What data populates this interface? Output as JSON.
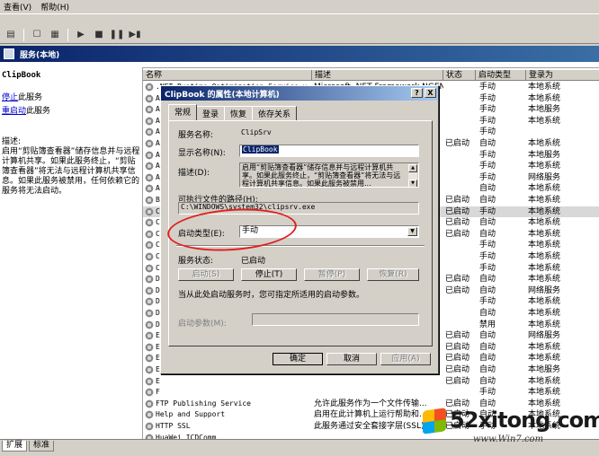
{
  "menu": [
    "查看(V)",
    "帮助(H)"
  ],
  "toolbar_icons": [
    "view-icon",
    "properties-icon",
    "list-icon",
    "play-icon",
    "stop-icon",
    "pause-icon",
    "step-icon"
  ],
  "header": {
    "title": "服务(本地)"
  },
  "left": {
    "title": "ClipBook",
    "stop_link": "停止",
    "stop_suffix": "此服务",
    "restart_link": "重启动",
    "restart_suffix": "此服务",
    "desc_label": "描述:",
    "desc_text": "启用“剪贴簿查看器”储存信息并与远程计算机共享。如果此服务终止，“剪贴簿查看器”将无法与远程计算机共享信息。如果此服务被禁用，任何依赖它的服务将无法启动。"
  },
  "columns": {
    "name": "名称",
    "desc": "描述",
    "status": "状态",
    "start": "启动类型",
    "logon": "登录为"
  },
  "rows": [
    {
      "name": ".NET Runtime Optimization Service v...",
      "desc": "Microsoft .NET Framework NGEN",
      "status": "",
      "start": "手动",
      "logon": "本地系统"
    },
    {
      "name": "A",
      "desc": "",
      "status": "",
      "start": "手动",
      "logon": "本地系统"
    },
    {
      "name": "A",
      "desc": "",
      "status": "",
      "start": "手动",
      "logon": "本地服务"
    },
    {
      "name": "A",
      "desc": "",
      "status": "",
      "start": "手动",
      "logon": "本地系统"
    },
    {
      "name": "A",
      "desc": "",
      "status": "",
      "start": "手动",
      "logon": ""
    },
    {
      "name": "A",
      "desc": "",
      "status": "已启动",
      "start": "自动",
      "logon": "本地系统"
    },
    {
      "name": "A",
      "desc": "",
      "status": "",
      "start": "手动",
      "logon": "本地服务"
    },
    {
      "name": "A",
      "desc": "",
      "status": "",
      "start": "手动",
      "logon": "本地系统"
    },
    {
      "name": "A",
      "desc": "",
      "status": "",
      "start": "手动",
      "logon": "网络服务"
    },
    {
      "name": "A",
      "desc": "",
      "status": "",
      "start": "自动",
      "logon": "本地系统"
    },
    {
      "name": "B",
      "desc": "",
      "status": "已启动",
      "start": "自动",
      "logon": "本地系统"
    },
    {
      "name": "C",
      "desc": "",
      "status": "已启动",
      "start": "手动",
      "logon": "本地系统"
    },
    {
      "name": "C",
      "desc": "",
      "status": "已启动",
      "start": "自动",
      "logon": "本地系统"
    },
    {
      "name": "C",
      "desc": "",
      "status": "已启动",
      "start": "自动",
      "logon": "本地系统"
    },
    {
      "name": "C",
      "desc": "",
      "status": "",
      "start": "手动",
      "logon": "本地系统"
    },
    {
      "name": "C",
      "desc": "",
      "status": "",
      "start": "手动",
      "logon": "本地系统"
    },
    {
      "name": "C",
      "desc": "",
      "status": "",
      "start": "手动",
      "logon": "本地系统"
    },
    {
      "name": "D",
      "desc": "",
      "status": "已启动",
      "start": "自动",
      "logon": "本地系统"
    },
    {
      "name": "D",
      "desc": "",
      "status": "已启动",
      "start": "自动",
      "logon": "网络服务"
    },
    {
      "name": "D",
      "desc": "",
      "status": "",
      "start": "手动",
      "logon": "本地系统"
    },
    {
      "name": "D",
      "desc": "",
      "status": "",
      "start": "自动",
      "logon": "本地系统"
    },
    {
      "name": "D",
      "desc": "",
      "status": "",
      "start": "禁用",
      "logon": "本地系统"
    },
    {
      "name": "E",
      "desc": "",
      "status": "已启动",
      "start": "自动",
      "logon": "网络服务"
    },
    {
      "name": "E",
      "desc": "",
      "status": "已启动",
      "start": "自动",
      "logon": "本地系统"
    },
    {
      "name": "E",
      "desc": "",
      "status": "已启动",
      "start": "自动",
      "logon": "本地系统"
    },
    {
      "name": "E",
      "desc": "",
      "status": "已启动",
      "start": "自动",
      "logon": "本地服务"
    },
    {
      "name": "E",
      "desc": "",
      "status": "已启动",
      "start": "自动",
      "logon": "本地系统"
    },
    {
      "name": "F",
      "desc": "",
      "status": "",
      "start": "手动",
      "logon": "本地系统"
    },
    {
      "name": "FTP Publishing Service",
      "desc": "允许此服务作为一个文件传输...",
      "status": "已启动",
      "start": "自动",
      "logon": "本地系统"
    },
    {
      "name": "Help and Support",
      "desc": "启用在此计算机上运行帮助和...",
      "status": "已启动",
      "start": "自动",
      "logon": "本地系统"
    },
    {
      "name": "HTTP SSL",
      "desc": "此服务通过安全套接字层(SSL)...",
      "status": "已启动",
      "start": "手动",
      "logon": "本地系统"
    },
    {
      "name": "HuaWei ICDComm",
      "desc": "",
      "status": "",
      "start": "",
      "logon": ""
    },
    {
      "name": "Human Interface Device Access",
      "desc": "启用对人体学接口设备(HID)的...",
      "status": "已启动",
      "start": "自动",
      "logon": "本地系统"
    },
    {
      "name": "IAS Jet Database Access",
      "desc": "",
      "status": "",
      "start": "",
      "logon": ""
    }
  ],
  "bottom_tabs": [
    "扩展",
    "标准"
  ],
  "dialog": {
    "title": "ClipBook 的属性(本地计算机)",
    "help_btn": "?",
    "close_btn": "X",
    "tabs": [
      "常规",
      "登录",
      "恢复",
      "依存关系"
    ],
    "service_name_label": "服务名称:",
    "service_name": "ClipSrv",
    "display_name_label": "显示名称(N):",
    "display_name": "ClipBook",
    "desc_label": "描述(D):",
    "desc": "启用“剪贴簿查看器”储存信息并与远程计算机共享。如果此服务终止，“剪贴簿查看器”将无法与远程计算机共享信息。如果此服务被禁用...",
    "path_label": "可执行文件的路径(H):",
    "path": "C:\\WINDOWS\\system32\\clipsrv.exe",
    "startup_label": "启动类型(E):",
    "startup_value": "手动",
    "status_label": "服务状态:",
    "status_value": "已启动",
    "start_btn": "启动(S)",
    "stop_btn": "停止(T)",
    "pause_btn": "暂停(P)",
    "resume_btn": "恢复(R)",
    "hint": "当从此处启动服务时，您可指定所适用的启动参数。",
    "params_label": "启动参数(M):",
    "ok": "确定",
    "cancel": "取消",
    "apply": "应用(A)"
  },
  "watermark": {
    "brand": "52xitong.com",
    "sub": "www.Win7.com"
  }
}
